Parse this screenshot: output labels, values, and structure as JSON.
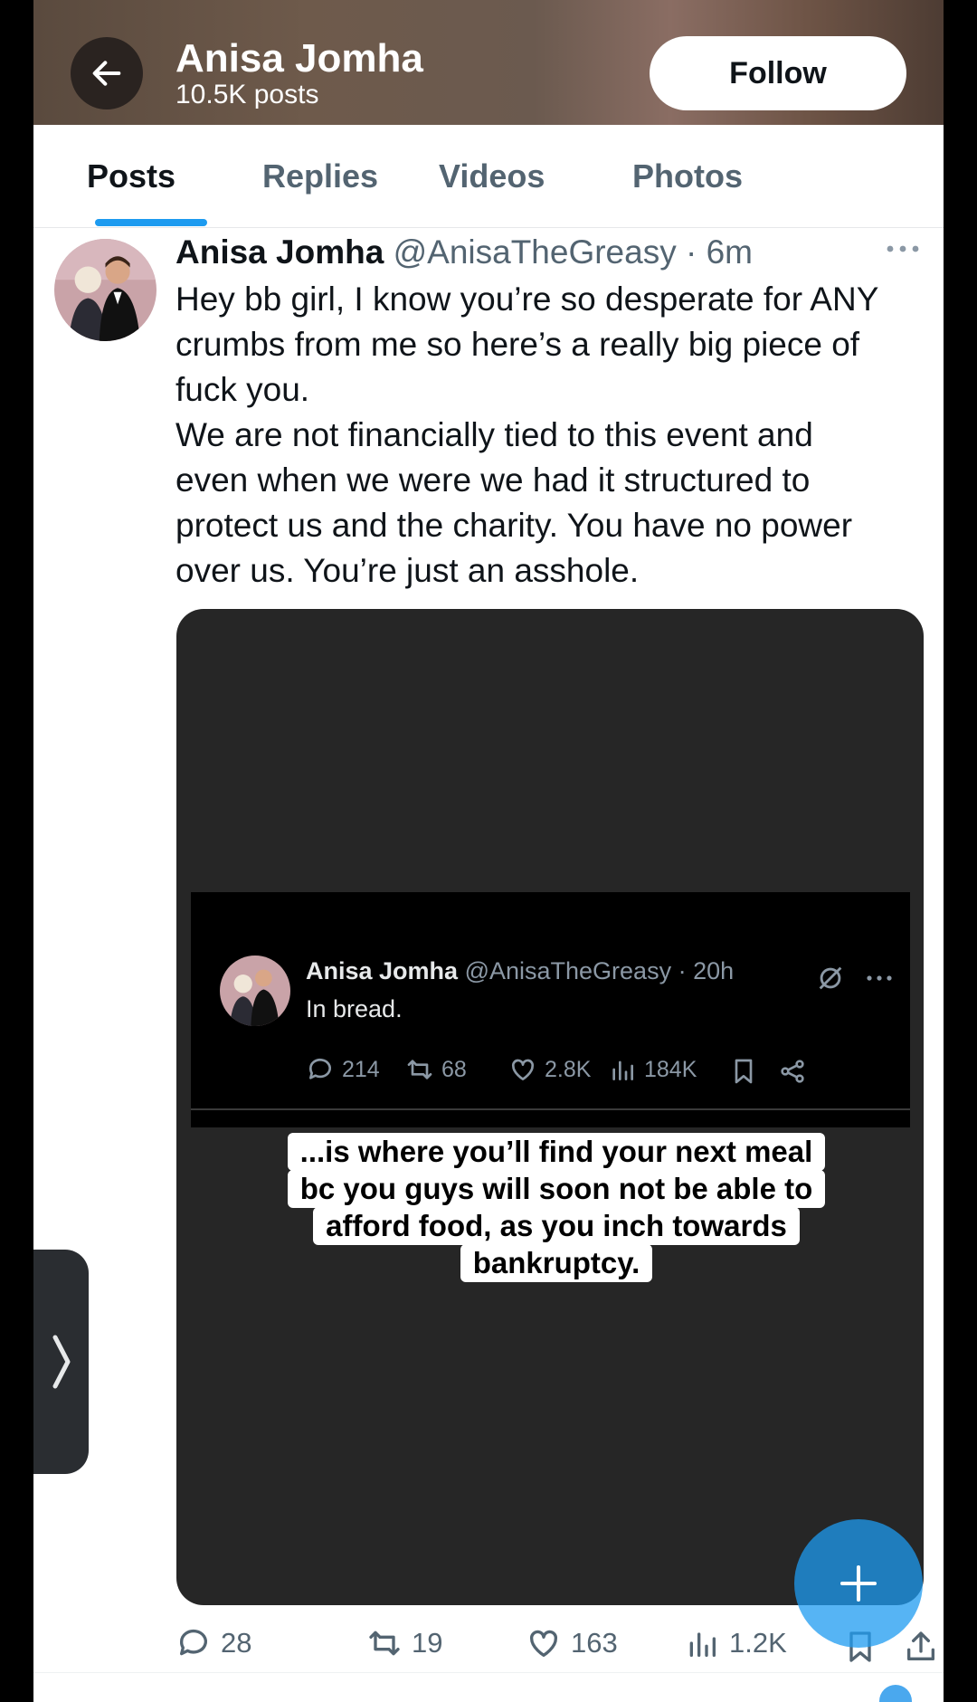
{
  "header": {
    "title": "Anisa Jomha",
    "posts_count": "10.5K posts",
    "follow_label": "Follow"
  },
  "tabs": [
    {
      "label": "Posts",
      "active": true
    },
    {
      "label": "Replies",
      "active": false
    },
    {
      "label": "Videos",
      "active": false
    },
    {
      "label": "Photos",
      "active": false
    }
  ],
  "post": {
    "name": "Anisa Jomha",
    "handle": "@AnisaTheGreasy",
    "separator": " · ",
    "time": "6m",
    "text_lines": [
      "Hey bb girl, I know you’re so desperate for ANY",
      "crumbs from me so here’s a really big piece of",
      "fuck you.",
      "We are not financially tied to this event and",
      "even when we were we had it structured to",
      "protect us and the charity. You have no power",
      "over us. You’re just an asshole."
    ],
    "media": {
      "embedded_post": {
        "name": "Anisa Jomha",
        "handle": "@AnisaTheGreasy",
        "time": "20h",
        "text": "In bread.",
        "replies": "214",
        "reposts": "68",
        "likes": "2.8K",
        "views": "184K"
      },
      "caption_lines": [
        "...is where you’ll find your next meal",
        "bc you guys will soon not be able to",
        "afford food, as you inch towards",
        "bankruptcy."
      ]
    },
    "stats": {
      "replies": "28",
      "reposts": "19",
      "likes": "163",
      "views": "1.2K"
    }
  },
  "colors": {
    "accent": "#1d9bf0",
    "text_primary": "#0f1419",
    "text_secondary": "#536471"
  },
  "icons": [
    "back-arrow-icon",
    "more-icon",
    "reply-icon",
    "repost-icon",
    "like-icon",
    "views-icon",
    "bookmark-icon",
    "share-icon",
    "compose-plus-icon",
    "chevron-right-icon",
    "no-edit-icon"
  ]
}
